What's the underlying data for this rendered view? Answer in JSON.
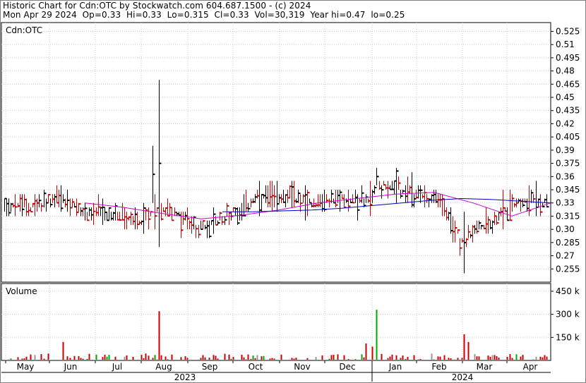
{
  "header": {
    "line1": "Historic Chart for Cdn:OTC by Stockwatch.com 604.687.1500 - (c) 2024",
    "line2": "Mon Apr 29 2024  Op=0.33  Hi=0.33  Lo=0.315  Cl=0.33  Vol=30,319  Year hi=0.47  lo=0.25"
  },
  "price_panel": {
    "label": "Cdn:OTC"
  },
  "volume_panel": {
    "label": "Volume"
  },
  "colors": {
    "up_bar": "#000000",
    "down_bar": "#cc0000",
    "ma_short": "#cc00cc",
    "ma_long": "#0000cc",
    "volume_default": "#cc0000",
    "volume_green": "#00aa00",
    "volume_grey": "#999999",
    "grid": "#c8c8c8",
    "frame": "#000000"
  },
  "chart_data": [
    {
      "type": "ohlc",
      "series_name": "Price",
      "y_scale": "linear",
      "ylim": [
        0.24,
        0.535
      ],
      "y_ticks": [
        "0.525",
        "0.51",
        "0.495",
        "0.48",
        "0.465",
        "0.45",
        "0.435",
        "0.42",
        "0.405",
        "0.39",
        "0.375",
        "0.36",
        "0.345",
        "0.33",
        "0.315",
        "0.30",
        "0.285",
        "0.27",
        "0.255"
      ],
      "x_months": [
        "May",
        "Jun",
        "Jul",
        "Aug",
        "Sep",
        "Oct",
        "Nov",
        "Dec",
        "Jan",
        "Feb",
        "Mar",
        "Apr"
      ],
      "x_years": [
        "2023",
        "2024"
      ],
      "grid": true,
      "highlights": [
        {
          "date": "2023-08-14",
          "high": 0.47,
          "low": 0.28
        },
        {
          "date": "2023-08-07",
          "high": 0.395,
          "low": 0.33
        },
        {
          "date": "2024-01-04",
          "high": 0.37,
          "low": 0.35
        },
        {
          "date": "2024-02-20",
          "high": 0.32,
          "low": 0.25
        }
      ],
      "moving_averages": [
        {
          "color_key": "ma_short",
          "approx_values": [
            0.33,
            0.325,
            0.318,
            0.312,
            0.316,
            0.322,
            0.33,
            0.335,
            0.34,
            0.342,
            0.33,
            0.315,
            0.33
          ]
        },
        {
          "color_key": "ma_long",
          "approx_values": [
            0.32,
            0.32,
            0.321,
            0.322,
            0.324,
            0.327,
            0.33,
            0.333,
            0.335,
            0.334,
            0.332,
            0.33
          ]
        }
      ]
    },
    {
      "type": "bar",
      "series_name": "Volume",
      "y_ticks": [
        "450 k",
        "300 k",
        "150 k"
      ],
      "ylim": [
        0,
        500000
      ],
      "peaks": [
        {
          "date": "2023-08-14",
          "value": 320000
        },
        {
          "date": "2024-01-04",
          "value": 330000
        },
        {
          "date": "2024-02-20",
          "value": 170000
        },
        {
          "date": "2023-12-27",
          "value": 110000
        },
        {
          "date": "2024-01-03",
          "value": 90000
        },
        {
          "date": "2023-06-07",
          "value": 120000
        },
        {
          "date": "2024-02-22",
          "value": 120000
        }
      ]
    }
  ]
}
